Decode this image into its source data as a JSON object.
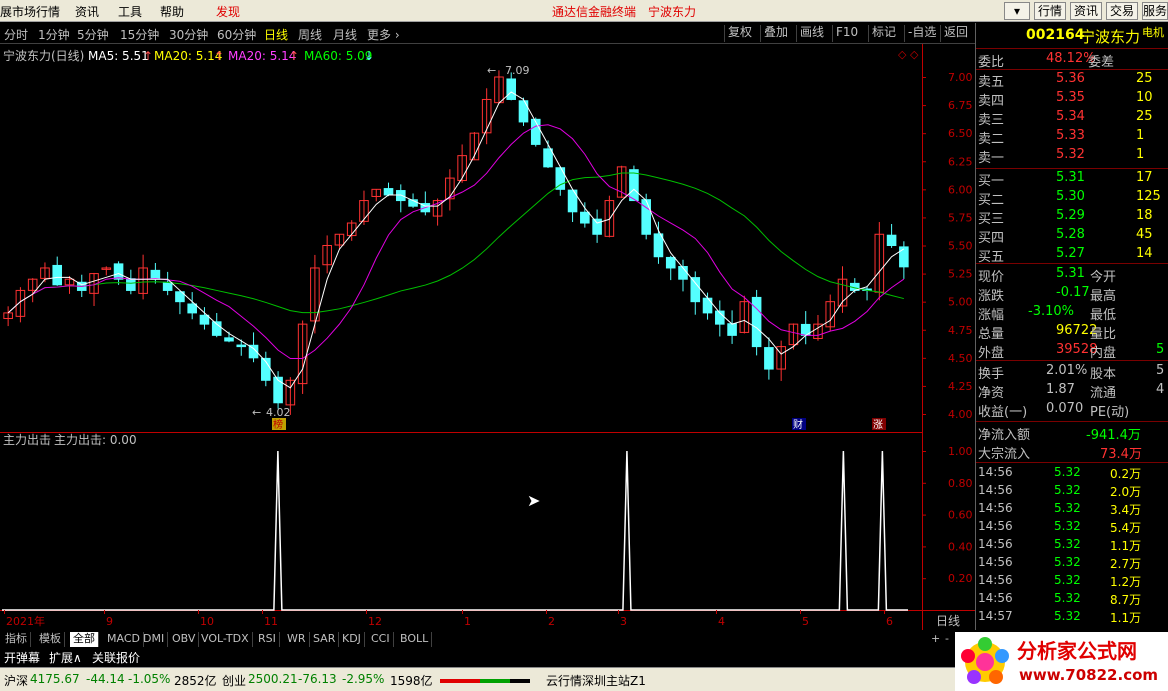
{
  "menu": {
    "items": [
      "展市场行情",
      "资讯",
      "工具",
      "帮助",
      "发现"
    ],
    "center_title": "通达信金融终端",
    "center_stock": "宁波东力",
    "right_buttons": [
      "行情",
      "资讯",
      "交易",
      "服务"
    ]
  },
  "periods": [
    "分时",
    "1分钟",
    "5分钟",
    "15分钟",
    "30分钟",
    "60分钟",
    "日线",
    "周线",
    "月线",
    "更多"
  ],
  "active_period": "日线",
  "tools": [
    "复权",
    "叠加",
    "画线",
    "F10",
    "标记",
    "-自选",
    "返回"
  ],
  "chart_header": {
    "name": "宁波东力(日线)",
    "ma5": "MA5: 5.51",
    "ma20a": "MA20: 5.14",
    "ma20b": "MA20: 5.14",
    "ma60": "MA60: 5.09"
  },
  "indicator_header": {
    "name": "主力出击",
    "value": "主力出击: 0.00"
  },
  "price_axis": [
    "7.00",
    "6.75",
    "6.50",
    "6.25",
    "6.00",
    "5.75",
    "5.50",
    "5.25",
    "5.00",
    "4.75",
    "4.50",
    "4.25",
    "4.00"
  ],
  "ind_axis": [
    "1.00",
    "0.80",
    "0.60",
    "0.40",
    "0.20"
  ],
  "time_axis": [
    "2021年",
    "9",
    "10",
    "11",
    "12",
    "1",
    "2",
    "3",
    "4",
    "5",
    "6"
  ],
  "high_label": "7.09",
  "low_label": "4.02",
  "markers": [
    "榜",
    "财",
    "涨"
  ],
  "period_label": "日线",
  "colors": {
    "up": "#ff3232",
    "down": "#54ffff",
    "ma5": "#ffffff",
    "ma20": "#ff00ff",
    "ma60": "#00d000",
    "axis": "#c00000"
  },
  "chart_data": {
    "type": "candlestick",
    "ylim": [
      3.9,
      7.2
    ],
    "closes_approx": [
      4.9,
      5.1,
      5.2,
      5.3,
      5.15,
      5.2,
      5.1,
      5.25,
      5.3,
      5.2,
      5.1,
      5.3,
      5.2,
      5.1,
      5.0,
      4.9,
      4.8,
      4.7,
      4.65,
      4.6,
      4.5,
      4.3,
      4.1,
      4.3,
      4.8,
      5.3,
      5.5,
      5.6,
      5.7,
      5.9,
      6.0,
      5.95,
      5.9,
      5.85,
      5.8,
      5.9,
      6.1,
      6.3,
      6.5,
      6.8,
      7.0,
      6.8,
      6.6,
      6.4,
      6.2,
      6.0,
      5.8,
      5.7,
      5.6,
      5.9,
      6.2,
      5.9,
      5.6,
      5.4,
      5.3,
      5.2,
      5.0,
      4.9,
      4.8,
      4.7,
      5.0,
      4.6,
      4.4,
      4.6,
      4.8,
      4.7,
      4.8,
      5.0,
      5.2,
      5.1,
      5.1,
      5.6,
      5.5,
      5.31
    ],
    "indicator": {
      "name": "主力出击",
      "spikes_fraction_of_width": [
        0.285,
        0.643,
        0.865,
        0.905
      ],
      "value": 1.0
    }
  },
  "quote": {
    "code": "002164",
    "name": "宁波东力",
    "sector": "电机",
    "weibi_label": "委比",
    "weibi": "48.12%",
    "weicha_label": "委差",
    "asks": [
      {
        "label": "卖五",
        "price": "5.36",
        "vol": "25"
      },
      {
        "label": "卖四",
        "price": "5.35",
        "vol": "10"
      },
      {
        "label": "卖三",
        "price": "5.34",
        "vol": "25"
      },
      {
        "label": "卖二",
        "price": "5.33",
        "vol": "1"
      },
      {
        "label": "卖一",
        "price": "5.32",
        "vol": "1"
      }
    ],
    "bids": [
      {
        "label": "买一",
        "price": "5.31",
        "vol": "17"
      },
      {
        "label": "买二",
        "price": "5.30",
        "vol": "125"
      },
      {
        "label": "买三",
        "price": "5.29",
        "vol": "18"
      },
      {
        "label": "买四",
        "price": "5.28",
        "vol": "45"
      },
      {
        "label": "买五",
        "price": "5.27",
        "vol": "14"
      }
    ],
    "stats": [
      {
        "l": "现价",
        "v": "5.31",
        "l2": "今开",
        "c": "#00ff00"
      },
      {
        "l": "涨跌",
        "v": "-0.17",
        "l2": "最高",
        "c": "#00ff00"
      },
      {
        "l": "涨幅",
        "v": "-3.10%",
        "l2": "最低",
        "c": "#00ff00"
      },
      {
        "l": "总量",
        "v": "96722",
        "l2": "量比",
        "c": "#ffff00"
      },
      {
        "l": "外盘",
        "v": "39528",
        "l2": "内盘",
        "c": "#ff3232",
        "v2": "5"
      }
    ],
    "stats2": [
      {
        "l": "换手",
        "v": "2.01%",
        "l2": "股本",
        "v2": "5"
      },
      {
        "l": "净资",
        "v": "1.87",
        "l2": "流通",
        "v2": "4"
      },
      {
        "l": "收益(一)",
        "v": "0.070",
        "l2": "PE(动)",
        "v2": ""
      }
    ],
    "flow": [
      {
        "l": "净流入额",
        "v": "-941.4万",
        "c": "#00ff00"
      },
      {
        "l": "大宗流入",
        "v": "73.4万",
        "c": "#ff3232"
      }
    ],
    "ticks": [
      {
        "t": "14:56",
        "p": "5.32",
        "v": "0.2万"
      },
      {
        "t": "14:56",
        "p": "5.32",
        "v": "2.0万"
      },
      {
        "t": "14:56",
        "p": "5.32",
        "v": "3.4万"
      },
      {
        "t": "14:56",
        "p": "5.32",
        "v": "5.4万"
      },
      {
        "t": "14:56",
        "p": "5.32",
        "v": "1.1万"
      },
      {
        "t": "14:56",
        "p": "5.32",
        "v": "2.7万"
      },
      {
        "t": "14:56",
        "p": "5.32",
        "v": "1.2万"
      },
      {
        "t": "14:56",
        "p": "5.32",
        "v": "8.7万"
      },
      {
        "t": "14:57",
        "p": "5.32",
        "v": "1.1万"
      }
    ]
  },
  "tabs": [
    "指标",
    "模板",
    "全部",
    "MACD",
    "DMI",
    "OBV",
    "VOL-TDX",
    "RSI",
    "WR",
    "SAR",
    "KDJ",
    "CCI",
    "BOLL"
  ],
  "active_tab": "全部",
  "tabs2": [
    "开弹幕",
    "扩展∧",
    "关联报价"
  ],
  "status": {
    "sh_label": "沪深",
    "sh_value": "4175.67",
    "sh_change": "-44.14",
    "sh_pct": "-1.05%",
    "sh_amount": "2852亿",
    "cy_label": "创业",
    "cy_value": "2500.21",
    "cy_change": "-76.13",
    "cy_pct": "-2.95%",
    "cy_amount": "1598亿",
    "server": "云行情深圳主站Z1"
  },
  "logo": {
    "text": "分析家公式网",
    "url": "www.70822.com"
  }
}
